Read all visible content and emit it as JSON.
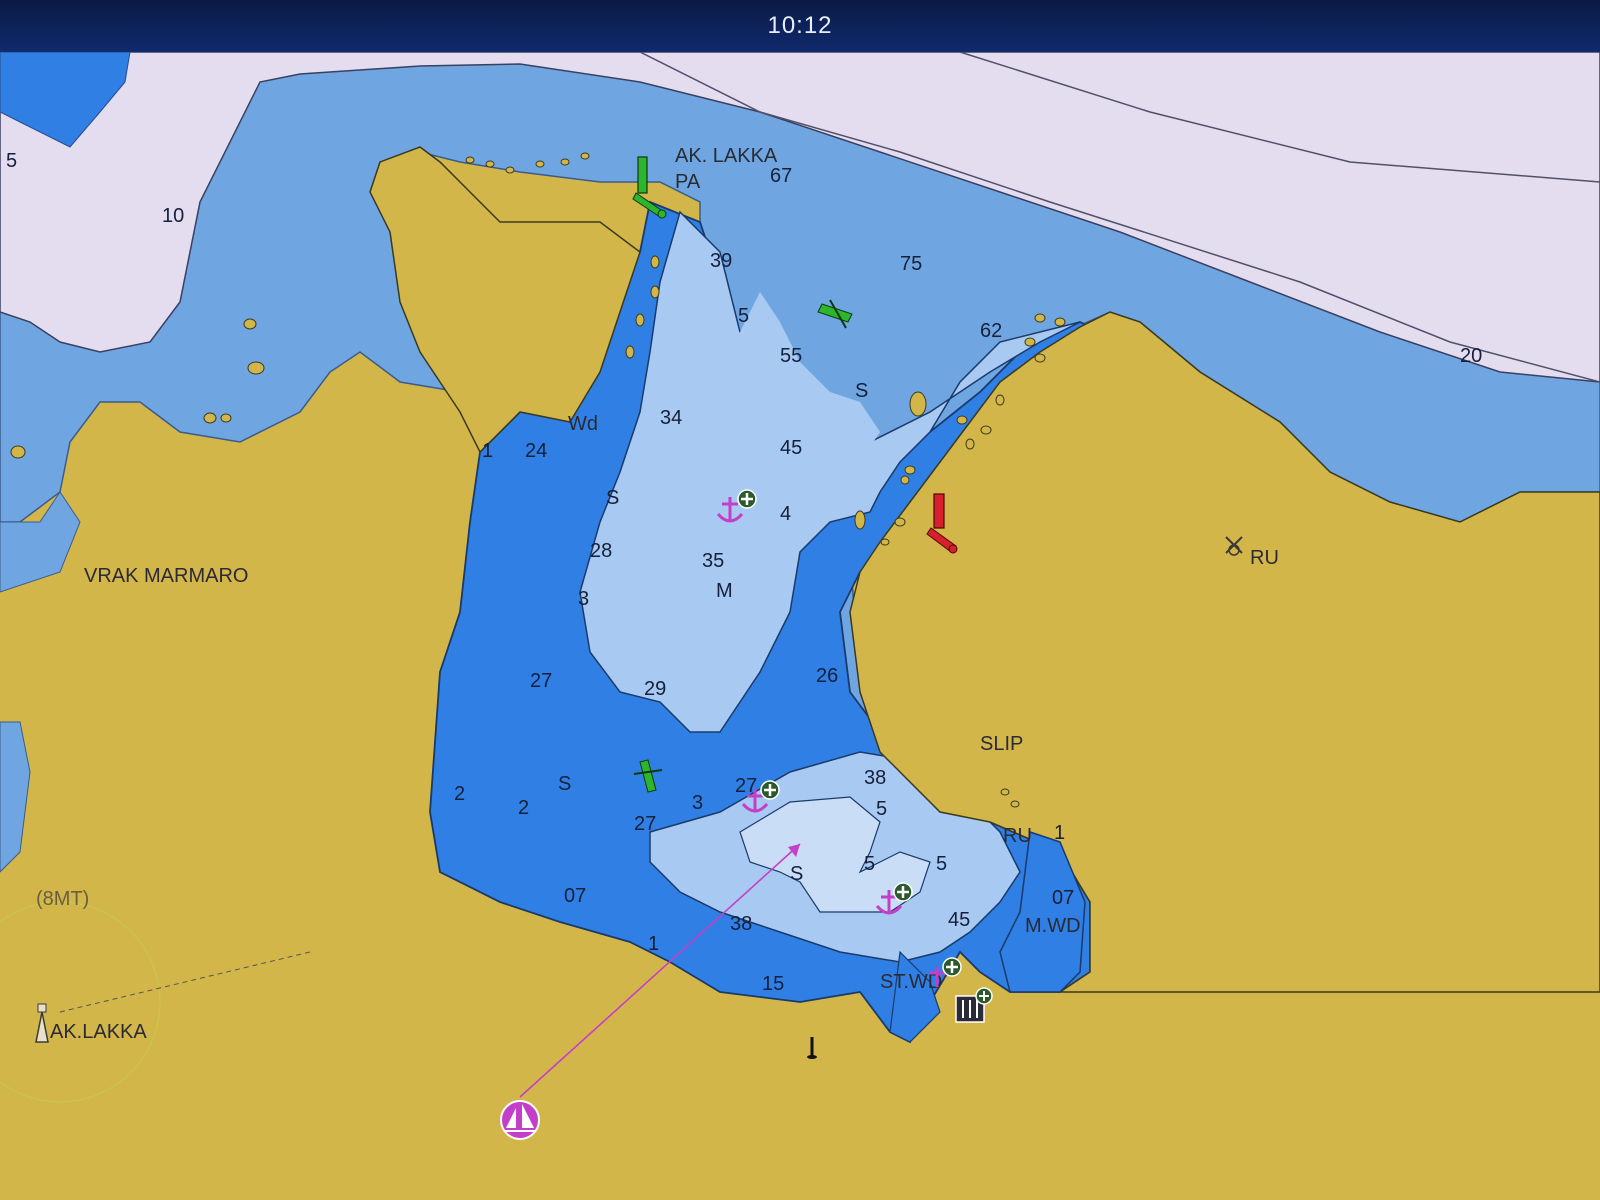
{
  "status_bar": {
    "time": "10:12"
  },
  "colors": {
    "land": "#d3b64a",
    "deep_water": "#e4dcef",
    "mid_water": "#6fa6e2",
    "shallow_water": "#2f7fe4",
    "very_shallow": "#a8caf2",
    "starboard_marker": "#2db52d",
    "port_marker": "#d8202c",
    "anchorage": "#c43fc8",
    "vessel": "#c43fc8"
  },
  "labels": {
    "ak_lakka_top": "AK. LAKKA",
    "pa": "PA",
    "vrak_marmaro": "VRAK MARMARO",
    "slip": "SLIP",
    "ru_east": "RU",
    "ru_bay": "RU",
    "m_wd": "M.WD",
    "st_wd": "ST.WD",
    "light_range": "(8MT)",
    "ak_lakka_light": "AK.LAKKA",
    "wd_small": "Wd"
  },
  "depths": {
    "d5_nw": "5",
    "d10": "10",
    "d6_7": "67",
    "d3_9": "39",
    "d7_5": "75",
    "d5_a": "5",
    "d6_2": "62",
    "d5_5": "55",
    "d20": "20",
    "s1": "S",
    "d3_4": "34",
    "d2_4": "24",
    "d1": "1",
    "d4_5": "45",
    "s2": "S",
    "d4": "4",
    "d2_8": "28",
    "d3_5": "35",
    "m": "M",
    "d3": "3",
    "d2_7a": "27",
    "d2_9": "29",
    "d2_6": "26",
    "d2_a": "2",
    "s3": "S",
    "d2_b": "2",
    "d2_7b": "27",
    "d3_8a": "38",
    "d3_b": "3",
    "d2_7c": "27",
    "d5_b": "5",
    "d5_c": "5",
    "d5_d": "5",
    "s4": "S",
    "d1_b": "1",
    "d0_7a": "07",
    "d0_7b": "07",
    "d4_5b": "45",
    "d3_8b": "38",
    "d1_c": "1",
    "d1_5": "15"
  }
}
